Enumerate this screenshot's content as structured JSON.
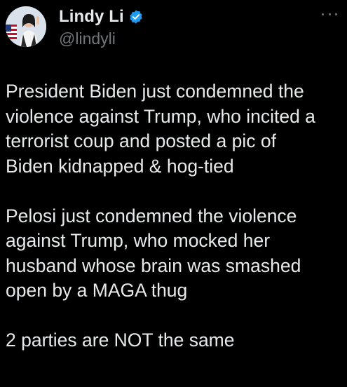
{
  "author": {
    "display_name": "Lindy Li",
    "handle": "@lindyli",
    "verified_color": "#1d9bf0",
    "avatar": "profile-photo"
  },
  "menu": {
    "icon": "more-horizontal-icon"
  },
  "tweet": {
    "paragraphs": [
      "President Biden just condemned the\nviolence against Trump, who incited a\nterrorist coup and posted a pic of\nBiden kidnapped & hog-tied",
      "Pelosi just condemned the violence\nagainst Trump, who mocked her\nhusband whose brain was smashed\nopen by a MAGA thug",
      "2 parties are NOT the same"
    ]
  },
  "colors": {
    "background": "#000000",
    "text_primary": "#e7e9ea",
    "text_secondary": "#71767b"
  }
}
